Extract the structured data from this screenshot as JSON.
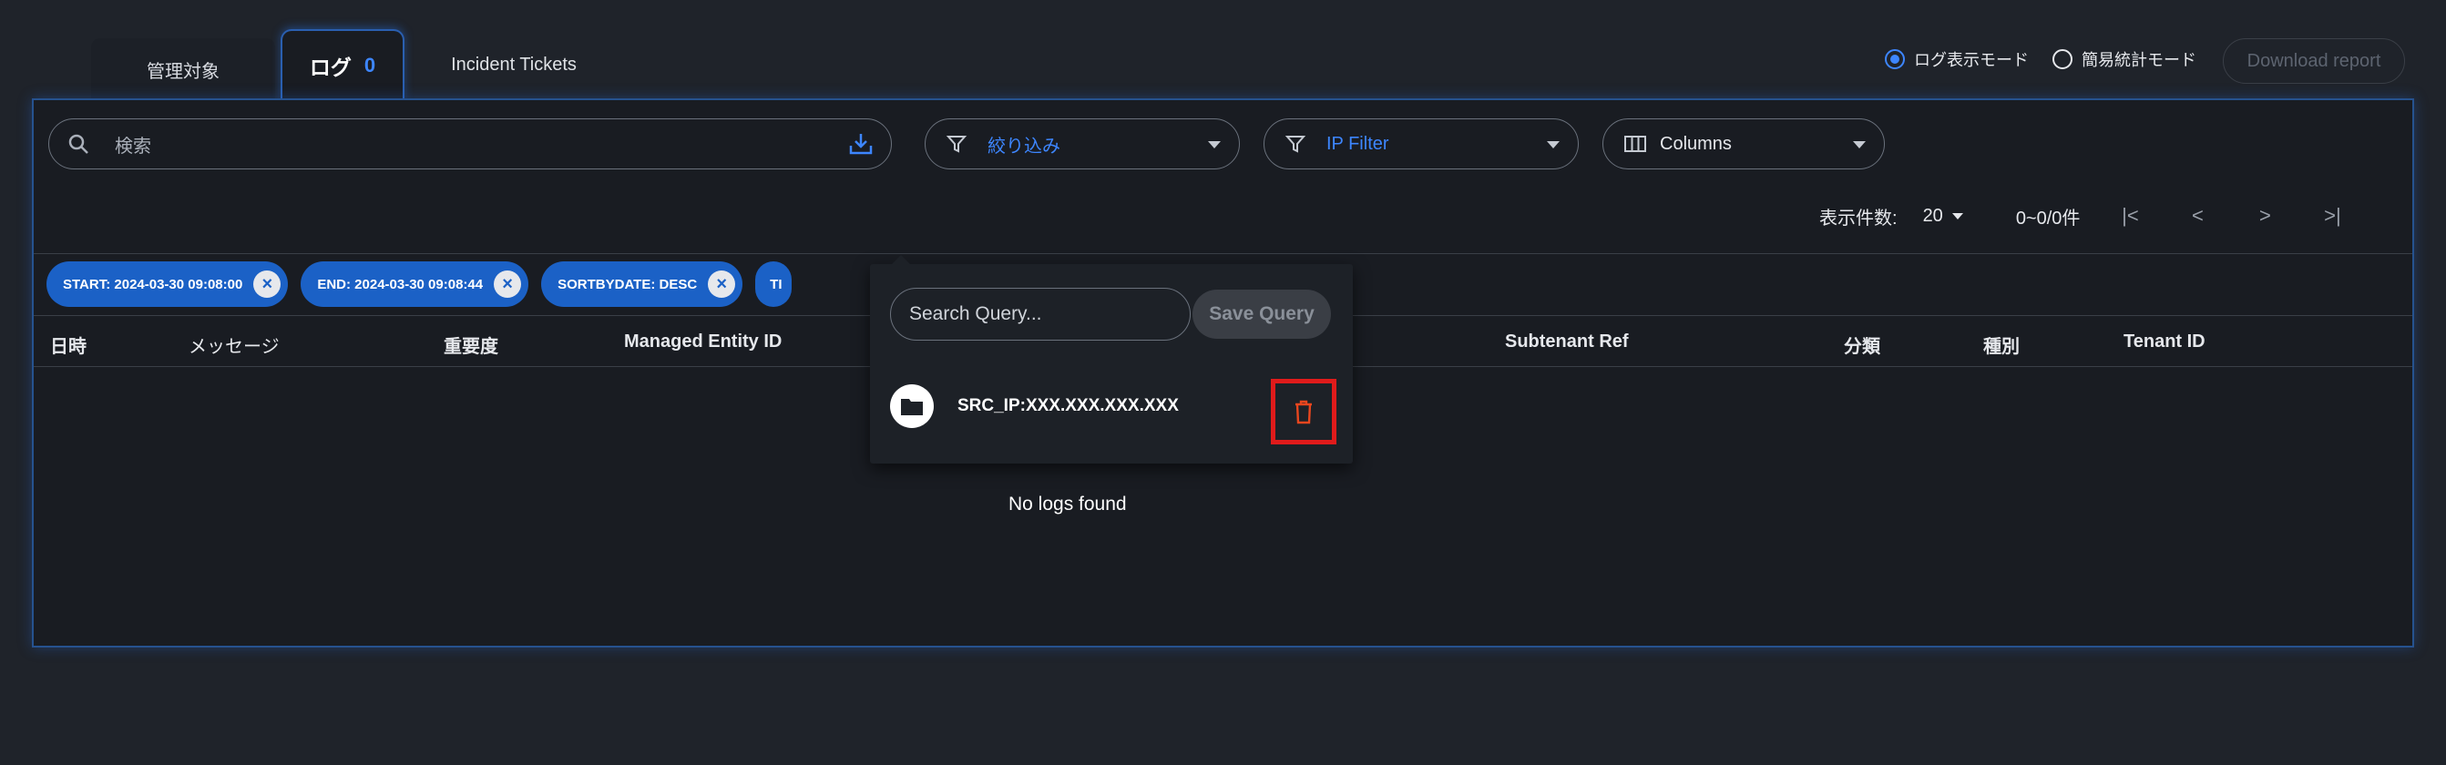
{
  "tabs": [
    {
      "label": "管理対象"
    },
    {
      "label": "ログ",
      "count": "0"
    },
    {
      "label": "Incident Tickets"
    }
  ],
  "modes": [
    {
      "label": "ログ表示モード",
      "selected": true
    },
    {
      "label": "簡易統計モード",
      "selected": false
    }
  ],
  "download_report_label": "Download report",
  "toolbar": {
    "search_placeholder": "検索",
    "filter_label": "絞り込み",
    "ip_filter_label": "IP Filter",
    "columns_label": "Columns"
  },
  "pager": {
    "per_page_label": "表示件数:",
    "per_page_value": "20",
    "range": "0~0/0件"
  },
  "chips": [
    {
      "label": "START: 2024-03-30 09:08:00"
    },
    {
      "label": "END: 2024-03-30 09:08:44"
    },
    {
      "label": "SORTBYDATE: DESC"
    },
    {
      "label": "TI"
    }
  ],
  "columns": [
    "日時",
    "メッセージ",
    "重要度",
    "Managed Entity ID",
    "Subtenant Ref",
    "分類",
    "種別",
    "Tenant ID"
  ],
  "empty_message": "No logs found",
  "popup": {
    "search_placeholder": "Search Query...",
    "save_label": "Save Query",
    "saved_queries": [
      {
        "name": "SRC_IP:XXX.XXX.XXX.XXX"
      }
    ]
  },
  "colors": {
    "accent": "#3d86ff",
    "chip_bg": "#1b61c6",
    "highlight": "#e01b1b"
  }
}
